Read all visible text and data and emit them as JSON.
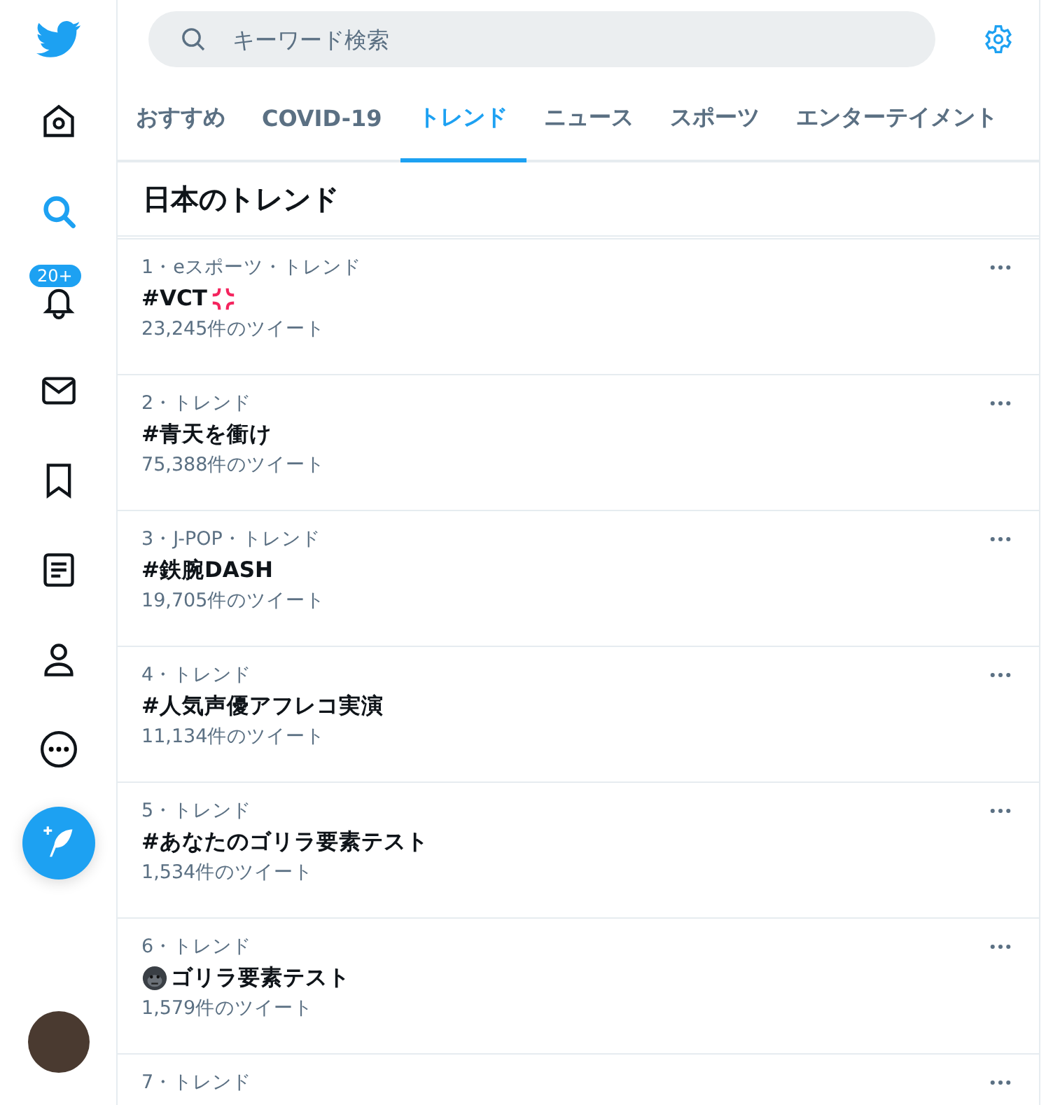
{
  "search": {
    "placeholder": "キーワード検索"
  },
  "notifications_badge": "20+",
  "tabs": [
    {
      "label": "おすすめ",
      "selected": false
    },
    {
      "label": "COVID-19",
      "selected": false
    },
    {
      "label": "トレンド",
      "selected": true
    },
    {
      "label": "ニュース",
      "selected": false
    },
    {
      "label": "スポーツ",
      "selected": false
    },
    {
      "label": "エンターテイメント",
      "selected": false
    }
  ],
  "section_title": "日本のトレンド",
  "trends": [
    {
      "meta": "1・eスポーツ・トレンド",
      "title": "#VCT",
      "kind": "anger",
      "count": "23,245件のツイート"
    },
    {
      "meta": "2・トレンド",
      "title": "#青天を衝け",
      "kind": "plain",
      "count": "75,388件のツイート"
    },
    {
      "meta": "3・J-POP・トレンド",
      "title": "#鉄腕DASH",
      "kind": "plain",
      "count": "19,705件のツイート"
    },
    {
      "meta": "4・トレンド",
      "title": "#人気声優アフレコ実演",
      "kind": "plain",
      "count": "11,134件のツイート"
    },
    {
      "meta": "5・トレンド",
      "title": "#あなたのゴリラ要素テスト",
      "kind": "plain",
      "count": "1,534件のツイート"
    },
    {
      "meta": "6・トレンド",
      "title": "ゴリラ要素テスト",
      "kind": "gorilla",
      "count": "1,579件のツイート"
    },
    {
      "meta": "7・トレンド"
    }
  ]
}
